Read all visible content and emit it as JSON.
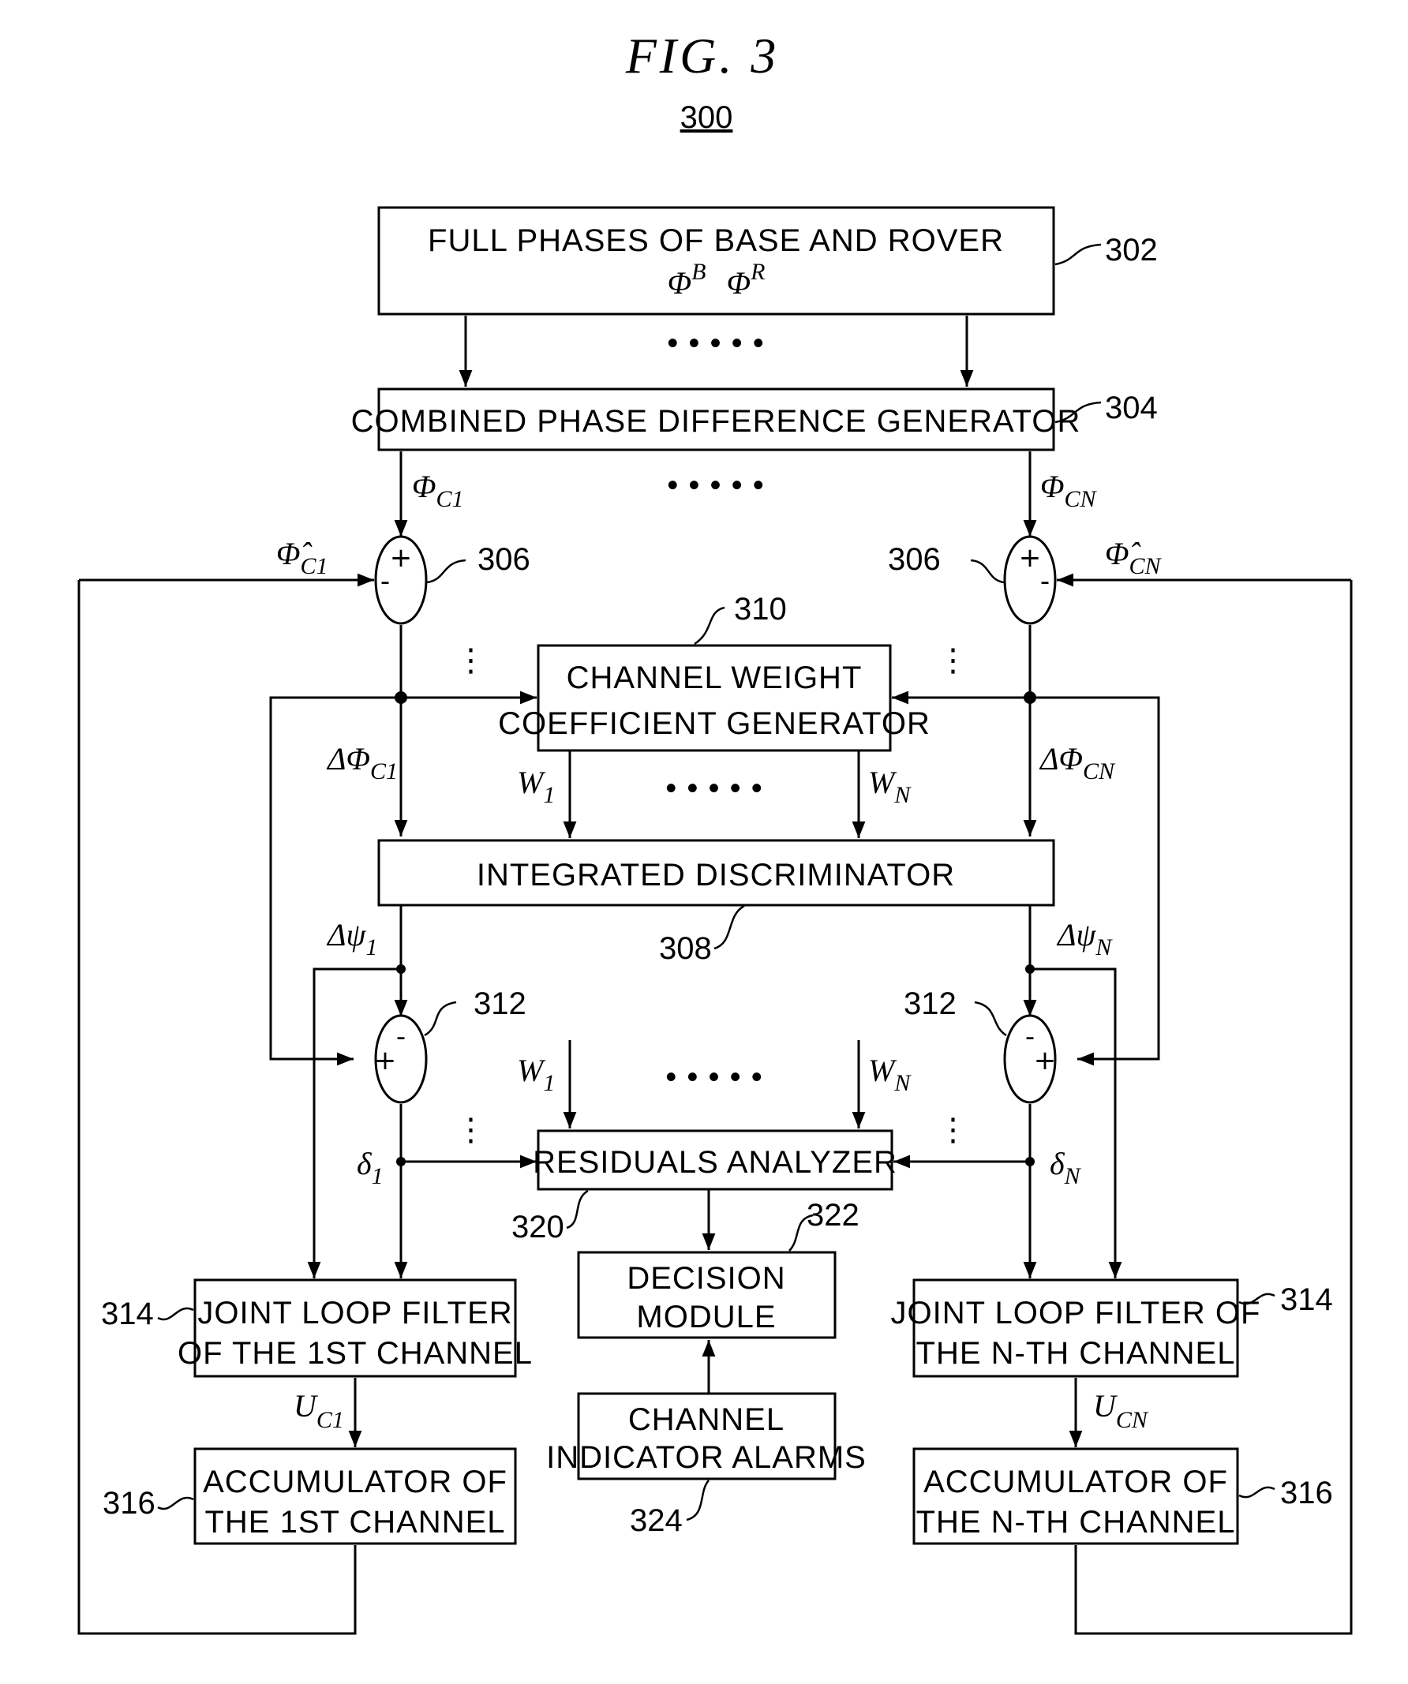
{
  "figure": {
    "title": "FIG.  3",
    "number": "300"
  },
  "blocks": {
    "full_phases": {
      "ref": "302",
      "line1": "FULL PHASES OF BASE AND ROVER",
      "sym1": "Φ",
      "sup1": "B",
      "sym2": "Φ",
      "sup2": "R"
    },
    "combined_phase": {
      "ref": "304",
      "line1": "COMBINED PHASE DIFFERENCE GENERATOR"
    },
    "channel_weight": {
      "ref": "310",
      "line1": "CHANNEL WEIGHT",
      "line2": "COEFFICIENT GENERATOR"
    },
    "integrated_disc": {
      "ref": "308",
      "line1": "INTEGRATED DISCRIMINATOR"
    },
    "residuals": {
      "ref": "320",
      "line1": "RESIDUALS ANALYZER"
    },
    "decision": {
      "ref": "322",
      "line1": "DECISION",
      "line2": "MODULE"
    },
    "alarms": {
      "ref": "324",
      "line1": "CHANNEL",
      "line2": "INDICATOR ALARMS"
    },
    "loop_filter_1": {
      "ref": "314",
      "line1": "JOINT LOOP FILTER",
      "line2": "OF THE 1ST CHANNEL"
    },
    "loop_filter_n": {
      "ref": "314",
      "line1": "JOINT LOOP FILTER OF",
      "line2": "THE N-TH CHANNEL"
    },
    "accum_1": {
      "ref": "316",
      "line1": "ACCUMULATOR OF",
      "line2": "THE 1ST CHANNEL"
    },
    "accum_n": {
      "ref": "316",
      "line1": "ACCUMULATOR OF",
      "line2": "THE N-TH CHANNEL"
    }
  },
  "summers": {
    "s306_left": {
      "ref": "306",
      "top_sign": "+",
      "side_sign": "-"
    },
    "s306_right": {
      "ref": "306",
      "top_sign": "+",
      "side_sign": "-"
    },
    "s312_left": {
      "ref": "312",
      "top_sign": "-",
      "side_sign": "+"
    },
    "s312_right": {
      "ref": "312",
      "top_sign": "-",
      "side_sign": "+"
    }
  },
  "signals": {
    "phi_c1": {
      "base": "Φ",
      "sub": "C1"
    },
    "phi_cn": {
      "base": "Φ",
      "sub": "CN"
    },
    "phi_hat_c1": {
      "base": "Φ̂",
      "sub": "C1"
    },
    "phi_hat_cn": {
      "base": "Φ̂",
      "sub": "CN"
    },
    "dphi_c1": {
      "base": "ΔΦ",
      "sub": "C1"
    },
    "dphi_cn": {
      "base": "ΔΦ",
      "sub": "CN"
    },
    "w1_top": {
      "base": "W",
      "sub": "1"
    },
    "wn_top": {
      "base": "W",
      "sub": "N"
    },
    "dpsi_1": {
      "base": "Δψ",
      "sub": "1"
    },
    "dpsi_n": {
      "base": "Δψ",
      "sub": "N"
    },
    "w1_bottom": {
      "base": "W",
      "sub": "1"
    },
    "wn_bottom": {
      "base": "W",
      "sub": "N"
    },
    "delta_1": {
      "base": "δ",
      "sub": "1"
    },
    "delta_n": {
      "base": "δ",
      "sub": "N"
    },
    "u_c1": {
      "base": "U",
      "sub": "C1"
    },
    "u_cn": {
      "base": "U",
      "sub": "CN"
    }
  },
  "ellipsis": {
    "horizontal": "• • • • •",
    "vertical": "⋮"
  }
}
